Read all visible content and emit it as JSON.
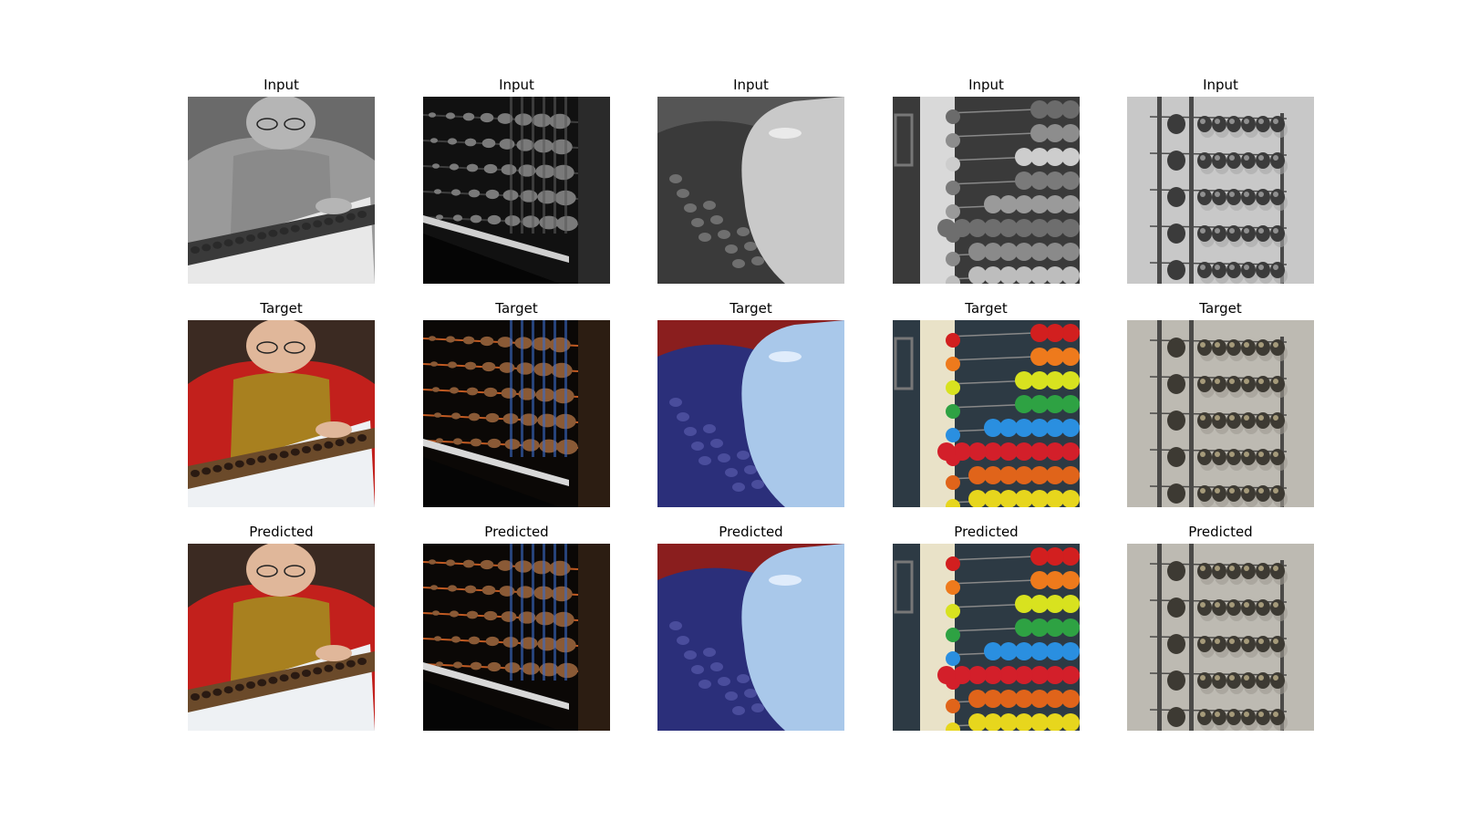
{
  "figure": {
    "row_titles": [
      "Input",
      "Target",
      "Predicted"
    ],
    "columns": [
      {
        "subject": "woman-using-abacus"
      },
      {
        "subject": "abacus-closeup-dark"
      },
      {
        "subject": "glossy-abacus-bead-closeup"
      },
      {
        "subject": "colorful-bead-abacus"
      },
      {
        "subject": "grey-bead-abacus-on-wall"
      }
    ]
  },
  "colors": {
    "background": "#ffffff",
    "title_text": "#000000"
  }
}
